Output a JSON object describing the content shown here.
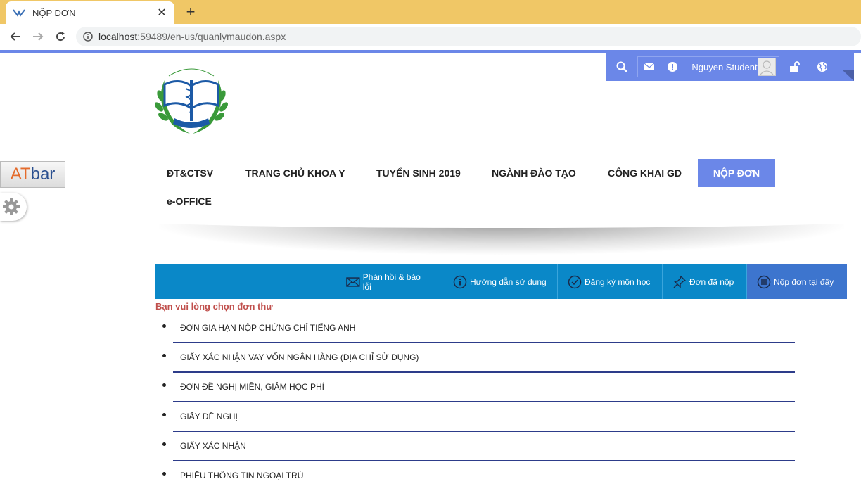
{
  "browser": {
    "tab_title": "NỘP ĐƠN",
    "close_glyph": "✕",
    "new_tab_glyph": "+",
    "url_host": "localhost",
    "url_path": ":59489/en-us/quanlymaudon.aspx"
  },
  "userbar": {
    "username": "Nguyen Student"
  },
  "atbar": {
    "at": "AT",
    "bar": "bar"
  },
  "nav": {
    "items": [
      {
        "label": "ĐT&CTSV"
      },
      {
        "label": "TRANG CHỦ KHOA Y"
      },
      {
        "label": "TUYỂN SINH 2019"
      },
      {
        "label": "NGÀNH ĐÀO TẠO"
      },
      {
        "label": "CÔNG KHAI GD"
      },
      {
        "label": "NỘP ĐƠN",
        "active": true
      },
      {
        "label": "e-OFFICE"
      }
    ]
  },
  "actions": [
    {
      "label": "Phản hồi & báo lỗi",
      "icon": "envelope-icon"
    },
    {
      "label": "Hướng dẫn sử dụng",
      "icon": "info-icon"
    },
    {
      "label": "Đăng ký môn học",
      "icon": "check-circle-icon"
    },
    {
      "label": "Đơn đã nộp",
      "icon": "pin-icon"
    },
    {
      "label": "Nộp đơn tại đây",
      "icon": "list-icon"
    }
  ],
  "prompt": "Bạn vui lòng chọn đơn thư",
  "forms": [
    "ĐƠN GIA HẠN NỘP CHỨNG CHỈ TIẾNG ANH",
    "GIẤY XÁC NHẬN VAY VỐN NGÂN HÀNG (ĐỊA CHỈ SỬ DỤNG)",
    "ĐƠN ĐỀ NGHỊ MIỄN, GIẢM HỌC PHÍ",
    "GIẤY ĐỀ NGHỊ",
    "GIẤY XÁC NHẬN",
    "PHIẾU THÔNG TIN NGOẠI TRÚ"
  ],
  "colors": {
    "tabstrip": "#f0c766",
    "brand_blue": "#6b87e8",
    "action_bar": "#0a88c8",
    "prompt_red": "#c0504d",
    "divider": "#2d3c8a"
  }
}
